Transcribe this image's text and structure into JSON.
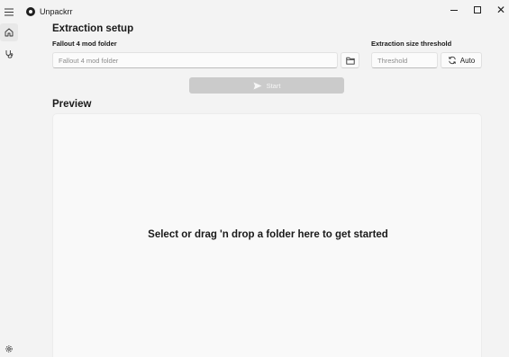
{
  "window": {
    "title": "Unpackrr",
    "controls": {
      "minimize": "minimize-icon",
      "maximize": "maximize-icon",
      "close": "✕"
    }
  },
  "nav": {
    "items": [
      {
        "icon": "hamburger-icon"
      },
      {
        "icon": "home-icon",
        "selected": true
      },
      {
        "icon": "stethoscope-icon"
      }
    ],
    "footer": {
      "icon": "gear-icon"
    }
  },
  "extraction": {
    "title": "Extraction setup",
    "folder_label": "Fallout 4 mod folder",
    "folder_placeholder": "Fallout 4 mod folder",
    "folder_value": "",
    "threshold_label": "Extraction size threshold",
    "threshold_placeholder": "Threshold",
    "threshold_value": "",
    "auto_label": "Auto",
    "start_label": "Start",
    "start_enabled": false
  },
  "preview": {
    "title": "Preview",
    "empty_message": "Select or drag 'n drop a folder here to get started"
  },
  "colors": {
    "background": "#f3f3f3",
    "text": "#1a1a1a",
    "disabled_button": "#cbcbcb",
    "drop_zone": "#f9f9f9"
  }
}
